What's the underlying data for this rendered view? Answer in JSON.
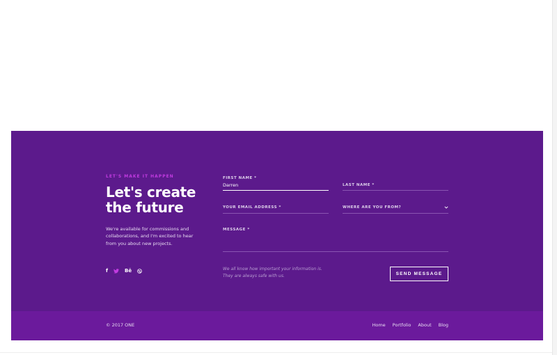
{
  "contact": {
    "eyebrow": "LET'S MAKE IT HAPPEN",
    "headline": "Let's create the future",
    "intro": "We're available for commissions and collaborations, and I'm excited to hear from you about new projects.",
    "socials": [
      {
        "icon": "facebook-icon",
        "glyph": "f"
      },
      {
        "icon": "twitter-icon"
      },
      {
        "icon": "behance-icon",
        "glyph": "Bē"
      },
      {
        "icon": "dribbble-icon"
      }
    ],
    "form": {
      "first_name_label": "FIRST NAME *",
      "first_name_value": "Darren",
      "last_name_label": "LAST NAME *",
      "email_label": "YOUR EMAIL ADDRESS *",
      "country_label": "WHERE ARE YOU FROM?",
      "message_label": "MESSAGE *",
      "privacy_note": "We all know how important your information is. They are always safe with us.",
      "send_label": "SEND MESSAGE"
    }
  },
  "footer": {
    "copyright": "© 2017 ONE",
    "nav": [
      "Home",
      "Portfolio",
      "About",
      "Blog"
    ]
  },
  "colors": {
    "contact_bg": "#5c1a8c",
    "footer_bg": "#6b1a9c",
    "accent": "#c13be0"
  }
}
